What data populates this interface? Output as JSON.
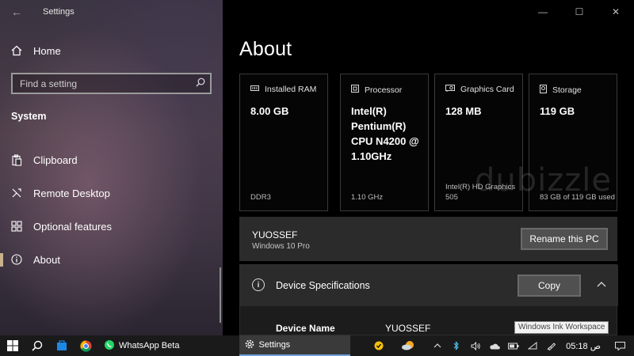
{
  "window": {
    "title": "Settings",
    "back_glyph": "←",
    "controls": {
      "minimize": "—",
      "maximize": "☐",
      "close": "✕"
    }
  },
  "sidebar": {
    "home_label": "Home",
    "search": {
      "placeholder": "Find a setting"
    },
    "section_title": "System",
    "items": [
      {
        "label": "Clipboard",
        "icon": "clipboard-icon"
      },
      {
        "label": "Remote Desktop",
        "icon": "remote-desktop-icon"
      },
      {
        "label": "Optional features",
        "icon": "optional-features-icon"
      },
      {
        "label": "About",
        "icon": "info-icon",
        "selected": true
      }
    ]
  },
  "main": {
    "title": "About",
    "cards": [
      {
        "head": "Installed RAM",
        "icon": "ram-icon",
        "value": "8.00 GB",
        "foot": "DDR3"
      },
      {
        "head": "Processor",
        "icon": "processor-icon",
        "value": "Intel(R) Pentium(R) CPU N4200 @ 1.10GHz",
        "foot": "1.10 GHz"
      },
      {
        "head": "Graphics Card",
        "icon": "graphics-card-icon",
        "value": "128 MB",
        "foot": "Intel(R) HD Graphics 505"
      },
      {
        "head": "Storage",
        "icon": "storage-icon",
        "value": "119 GB",
        "foot": "83 GB of 119 GB used"
      }
    ],
    "pc": {
      "name": "YUOSSEF",
      "edition": "Windows 10 Pro",
      "rename_label": "Rename this PC"
    },
    "specs": {
      "title": "Device Specifications",
      "copy_label": "Copy",
      "rows": [
        {
          "key": "Device Name",
          "value": "YUOSSEF"
        }
      ],
      "tooltip": "Windows Ink Workspace"
    },
    "watermark": "dubizzle"
  },
  "taskbar": {
    "apps": [
      {
        "label": "WhatsApp Beta",
        "icon": "whatsapp-icon"
      },
      {
        "label": "Settings",
        "icon": "gear-icon",
        "active": true
      }
    ],
    "clock": "05:18",
    "ampm": "ص"
  },
  "colors": {
    "accent": "#c9b38a",
    "panel": "#2b2b2b",
    "button": "#505050",
    "taskbar": "#1a1a1a"
  }
}
